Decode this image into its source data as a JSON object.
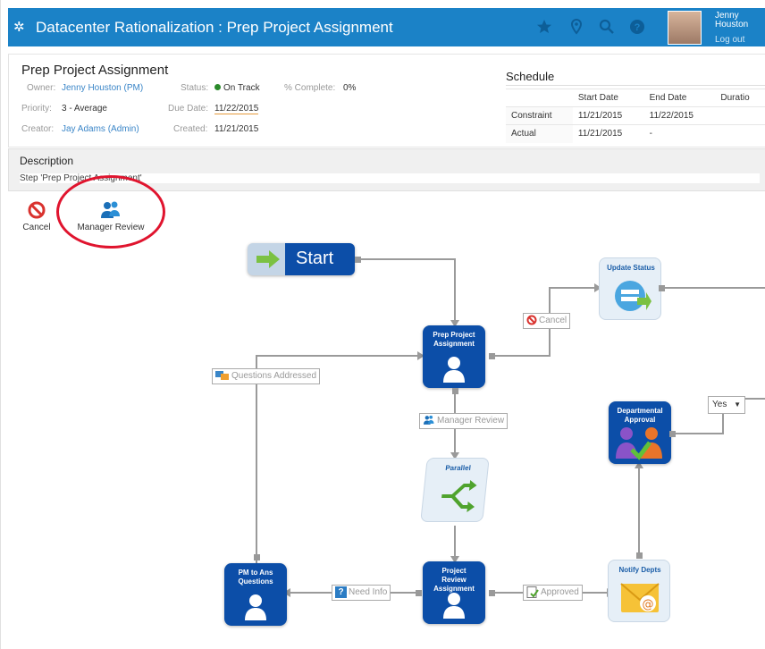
{
  "header": {
    "title": "Datacenter Rationalization : Prep Project Assignment",
    "user_first": "Jenny",
    "user_last": "Houston",
    "logout": "Log out",
    "icons": [
      "gear-icon",
      "star-icon",
      "map-pin-icon",
      "search-icon",
      "help-icon"
    ]
  },
  "info": {
    "heading": "Prep Project Assignment",
    "owner_label": "Owner:",
    "owner": "Jenny Houston (PM)",
    "priority_label": "Priority:",
    "priority": "3 - Average",
    "creator_label": "Creator:",
    "creator": "Jay Adams (Admin)",
    "status_label": "Status:",
    "status": "On Track",
    "due_label": "Due Date:",
    "due": "11/22/2015",
    "created_label": "Created:",
    "created": "11/21/2015",
    "complete_label": "% Complete:",
    "complete": "0%"
  },
  "schedule": {
    "title": "Schedule",
    "columns": [
      "",
      "Start Date",
      "End Date",
      "Duratio"
    ],
    "rows": [
      {
        "label": "Constraint",
        "start": "11/21/2015",
        "end": "11/22/2015"
      },
      {
        "label": "Actual",
        "start": "11/21/2015",
        "end": "-"
      }
    ]
  },
  "description": {
    "heading": "Description",
    "text": "Step 'Prep Project Assignment'"
  },
  "actions": {
    "cancel": "Cancel",
    "manager_review": "Manager Review"
  },
  "diagram": {
    "start": "Start",
    "update_status": "Update Status",
    "prep_line1": "Prep Project",
    "prep_line2": "Assignment",
    "parallel": "Parallel",
    "departmental_line1": "Departmental",
    "departmental_line2": "Approval",
    "pm_line1": "PM to Ans",
    "pm_line2": "Questions",
    "review_line1": "Project",
    "review_line2": "Review",
    "review_line3": "Assignment",
    "notify": "Notify Depts",
    "tag_cancel": "Cancel",
    "tag_questions": "Questions Addressed",
    "tag_manager": "Manager Review",
    "tag_need_info": "Need Info",
    "tag_approved": "Approved",
    "select_yes": "Yes"
  },
  "colors": {
    "header_blue": "#1b82c7",
    "node_blue": "#0c4ea8",
    "highlight_red": "#e0142e",
    "status_green": "#2a8a2a"
  }
}
